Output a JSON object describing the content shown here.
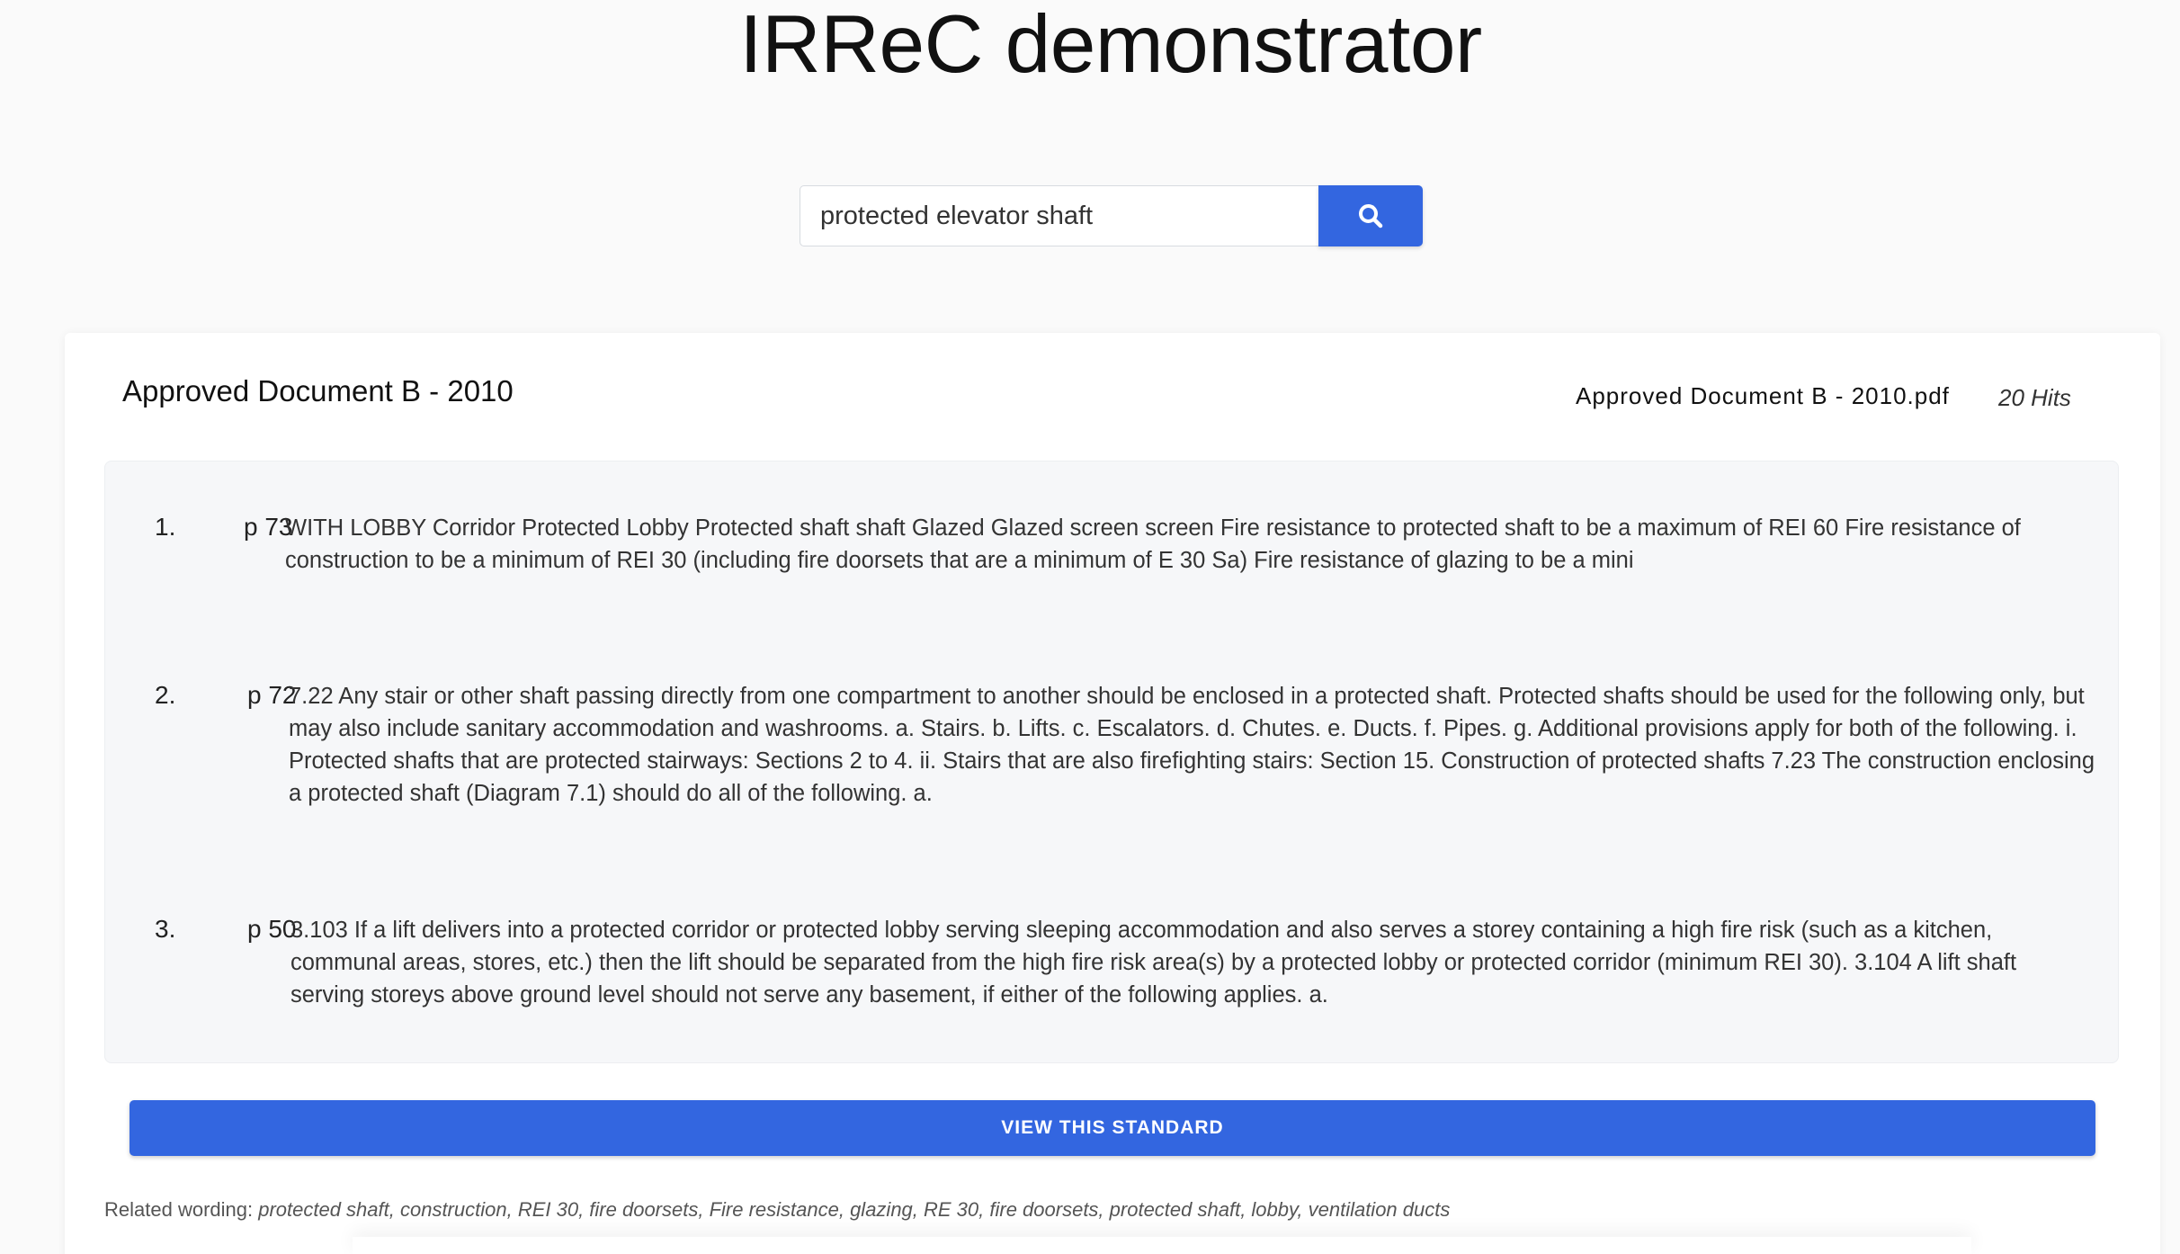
{
  "app": {
    "title": "IRReC demonstrator"
  },
  "search": {
    "value": "protected elevator shaft",
    "placeholder": "",
    "button_icon": "search-icon"
  },
  "document": {
    "title": "Approved Document B - 2010",
    "filename": "Approved Document B - 2010.pdf",
    "hits": "20 Hits",
    "results": [
      {
        "number": "1.",
        "page": "p 73",
        "text": "WITH LOBBY Corridor Protected Lobby Protected shaft shaft Glazed Glazed screen screen Fire resistance to protected shaft to be a maximum of REI 60 Fire resistance of construction to be a minimum of REI 30 (including fire doorsets that are a minimum of E 30 Sa) Fire resistance of glazing to be a mini"
      },
      {
        "number": "2.",
        "page": "p 72",
        "text": "7.22 Any stair or other shaft passing directly from one compartment to another should be enclosed in a protected shaft. Protected shafts should be used for the following only, but may also include sanitary accommodation and washrooms. a. Stairs. b. Lifts. c. Escalators. d. Chutes. e. Ducts. f. Pipes. g. Additional provisions apply for both of the following. i. Protected shafts that are protected stairways: Sections 2 to 4. ii. Stairs that are also firefighting stairs: Section 15. Construction of protected shafts 7.23 The construction enclosing a protected shaft (Diagram 7.1) should do all of the following. a."
      },
      {
        "number": "3.",
        "page": "p 50",
        "text": "3.103 If a lift delivers into a protected corridor or protected lobby serving sleeping accommodation and also serves a storey containing a high fire risk (such as a kitchen, communal areas, stores, etc.) then the lift should be separated from the high fire risk area(s) by a protected lobby or protected corridor (minimum REI 30). 3.104 A lift shaft serving storeys above ground level should not serve any basement, if either of the following applies. a."
      }
    ],
    "view_button_label": "VIEW THIS STANDARD",
    "related_label": "Related wording: ",
    "related_terms": "protected shaft, construction, REI 30, fire doorsets, Fire resistance, glazing, RE 30, fire doorsets, protected shaft, lobby, ventilation ducts"
  },
  "colors": {
    "accent": "#3366e0",
    "background": "#fafafa",
    "results_background": "#f6f7f9"
  }
}
